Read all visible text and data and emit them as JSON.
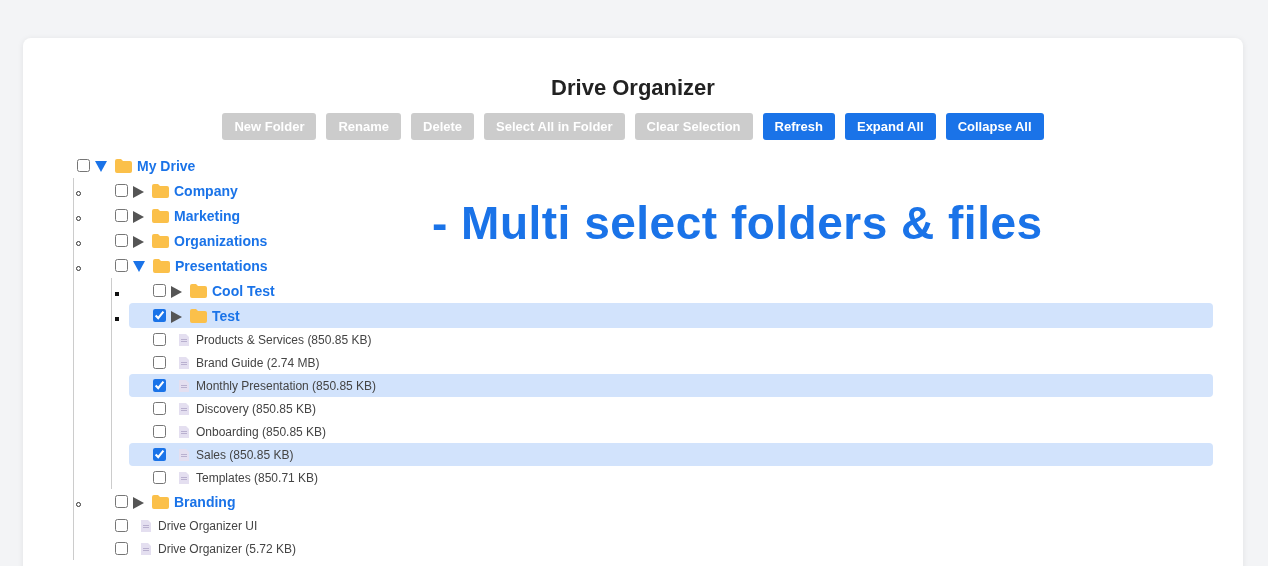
{
  "title": "Drive Organizer",
  "buttons": [
    {
      "label": "New Folder",
      "disabled": true
    },
    {
      "label": "Rename",
      "disabled": true
    },
    {
      "label": "Delete",
      "disabled": true
    },
    {
      "label": "Select All in Folder",
      "disabled": true
    },
    {
      "label": "Clear Selection",
      "disabled": true
    },
    {
      "label": "Refresh",
      "disabled": false
    },
    {
      "label": "Expand All",
      "disabled": false
    },
    {
      "label": "Collapse All",
      "disabled": false
    }
  ],
  "annotation": "- Multi select folders & files",
  "tree": [
    {
      "kind": "folder",
      "label": "My Drive",
      "checked": false,
      "expanded": true,
      "children": [
        {
          "kind": "folder",
          "label": "Company",
          "checked": false,
          "expanded": false
        },
        {
          "kind": "folder",
          "label": "Marketing",
          "checked": false,
          "expanded": false
        },
        {
          "kind": "folder",
          "label": "Organizations",
          "checked": false,
          "expanded": false
        },
        {
          "kind": "folder",
          "label": "Presentations",
          "checked": false,
          "expanded": true,
          "children": [
            {
              "kind": "folder",
              "label": "Cool Test",
              "checked": false,
              "expanded": false
            },
            {
              "kind": "folder",
              "label": "Test",
              "checked": true,
              "expanded": false
            },
            {
              "kind": "file",
              "label": "Products & Services (850.85 KB)",
              "checked": false
            },
            {
              "kind": "file",
              "label": "Brand Guide (2.74 MB)",
              "checked": false
            },
            {
              "kind": "file",
              "label": "Monthly Presentation (850.85 KB)",
              "checked": true
            },
            {
              "kind": "file",
              "label": "Discovery (850.85 KB)",
              "checked": false
            },
            {
              "kind": "file",
              "label": "Onboarding (850.85 KB)",
              "checked": false
            },
            {
              "kind": "file",
              "label": "Sales (850.85 KB)",
              "checked": true
            },
            {
              "kind": "file",
              "label": "Templates (850.71 KB)",
              "checked": false
            }
          ]
        },
        {
          "kind": "folder",
          "label": "Branding",
          "checked": false,
          "expanded": false
        },
        {
          "kind": "file",
          "label": "Drive Organizer UI",
          "checked": false
        },
        {
          "kind": "file",
          "label": "Drive Organizer (5.72 KB)",
          "checked": false
        }
      ]
    }
  ]
}
